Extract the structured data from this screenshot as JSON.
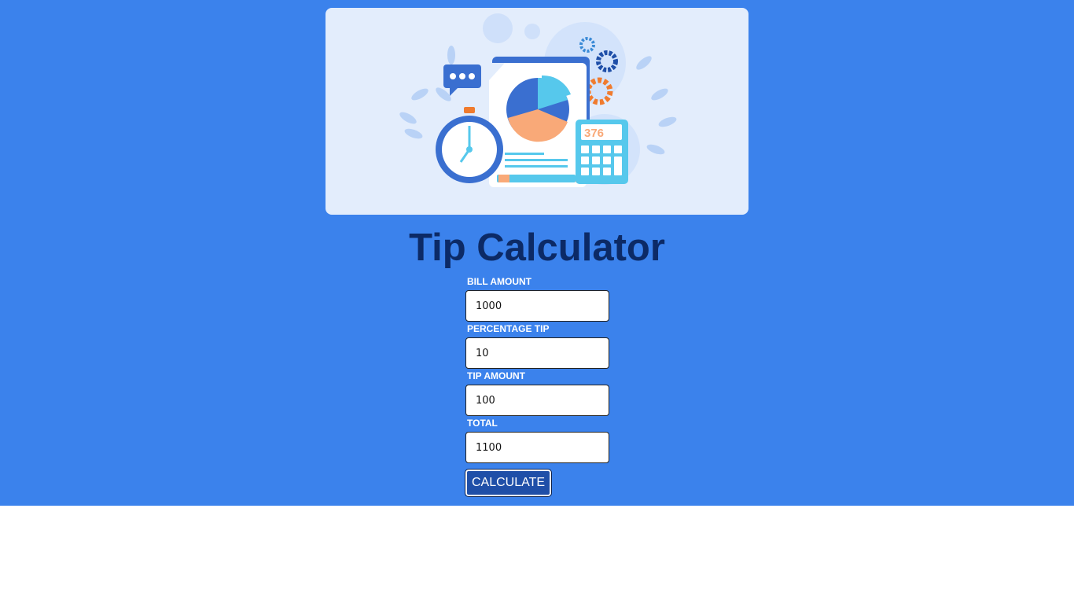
{
  "page": {
    "title": "Tip Calculator"
  },
  "hero": {
    "calculator_display": "376"
  },
  "form": {
    "bill_amount": {
      "label": "BILL AMOUNT",
      "value": "1000"
    },
    "percentage_tip": {
      "label": "PERCENTAGE TIP",
      "value": "10"
    },
    "tip_amount": {
      "label": "TIP AMOUNT",
      "value": "100"
    },
    "total": {
      "label": "TOTAL",
      "value": "1100"
    },
    "calculate_label": "CALCULATE"
  },
  "colors": {
    "background": "#3b82ec",
    "title": "#0c2a66",
    "button": "#1f4fa8",
    "hero_bg": "#e3edfc"
  }
}
